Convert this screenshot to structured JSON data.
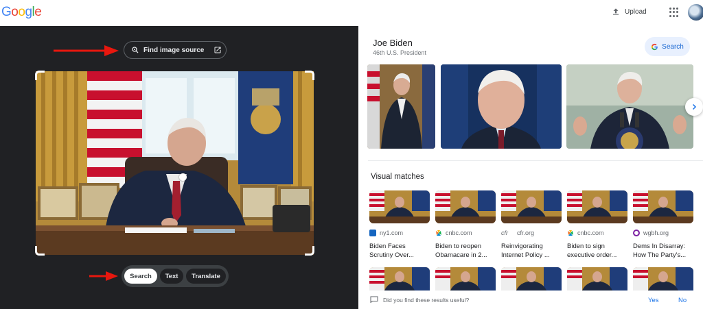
{
  "header": {
    "logo_text": "Google",
    "upload_label": "Upload",
    "upload_icon": "upload-icon",
    "apps_icon": "apps-grid-icon"
  },
  "left_panel": {
    "find_source_label": "Find image source",
    "find_source_icon": "lens-icon",
    "external_icon": "open-in-new-icon",
    "modes": [
      "Search",
      "Text",
      "Translate"
    ],
    "active_mode": "Search",
    "annotation_color": "#e8170e"
  },
  "knowledge_panel": {
    "title": "Joe Biden",
    "subtitle": "46th U.S. President",
    "search_label": "Search",
    "next_icon": "chevron-right-icon"
  },
  "visual_matches": {
    "title": "Visual matches",
    "items": [
      {
        "source": "ny1.com",
        "caption_1": "Biden Faces",
        "caption_2": "Scrutiny Over..."
      },
      {
        "source": "cnbc.com",
        "caption_1": "Biden to reopen",
        "caption_2": "Obamacare in 2..."
      },
      {
        "source": "cfr.org",
        "caption_1": "Reinvigorating",
        "caption_2": "Internet Policy ..."
      },
      {
        "source": "cnbc.com",
        "caption_1": "Biden to sign",
        "caption_2": "executive order..."
      },
      {
        "source": "wgbh.org",
        "caption_1": "Dems In Disarray:",
        "caption_2": "How The Party's..."
      }
    ]
  },
  "feedback": {
    "question": "Did you find these results useful?",
    "yes_label": "Yes",
    "no_label": "No"
  },
  "colors": {
    "dark_panel": "#202124",
    "link_blue": "#1a73e8",
    "chip_blue_bg": "#e8f0fe"
  }
}
